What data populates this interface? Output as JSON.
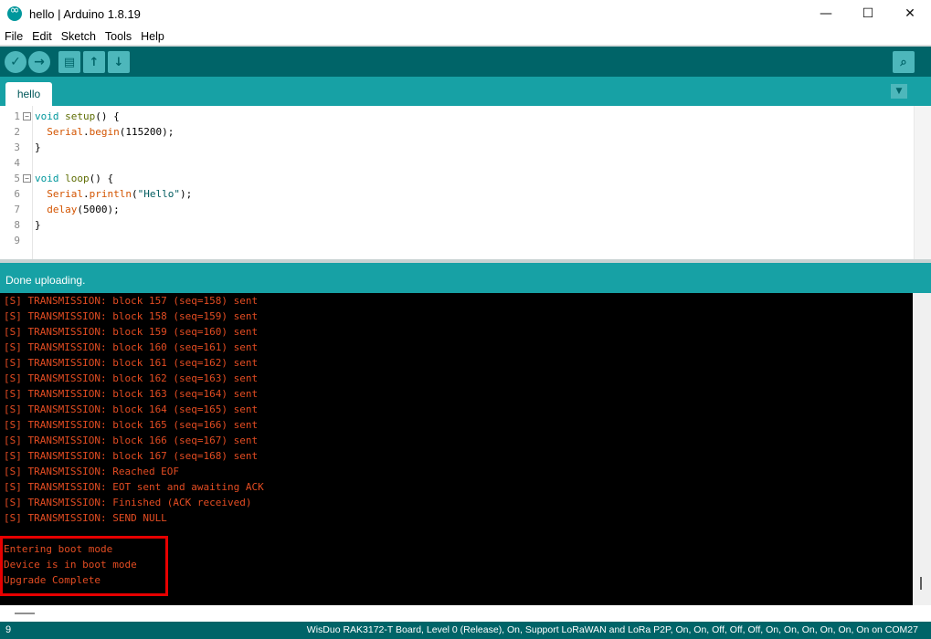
{
  "window": {
    "title": "hello | Arduino 1.8.19",
    "icon": "arduino-logo-icon",
    "controls": {
      "minimize": "—",
      "maximize": "☐",
      "close": "✕"
    }
  },
  "menu": [
    "File",
    "Edit",
    "Sketch",
    "Tools",
    "Help"
  ],
  "toolbar": {
    "verify": "✓",
    "upload": "→",
    "new": "▤",
    "open": "↑",
    "save": "↓",
    "serial_monitor": "⌕",
    "colors": {
      "bar": "#006468",
      "button": "#4db7bb"
    }
  },
  "tabs": [
    {
      "label": "hello",
      "active": true
    }
  ],
  "tab_menu_glyph": "▼",
  "editor": {
    "lines": [
      {
        "n": "1",
        "fold": "−"
      },
      {
        "n": "2"
      },
      {
        "n": "3"
      },
      {
        "n": "4"
      },
      {
        "n": "5",
        "fold": "−"
      },
      {
        "n": "6"
      },
      {
        "n": "7"
      },
      {
        "n": "8"
      },
      {
        "n": "9"
      }
    ],
    "code": {
      "l1_kw": "void",
      "l1_fn": "setup",
      "l1_rest": "() {",
      "l2_cls": "Serial",
      "l2_dot": ".",
      "l2_fn": "begin",
      "l2_rest": "(115200);",
      "l3": "}",
      "l5_kw": "void",
      "l5_fn": "loop",
      "l5_rest": "() {",
      "l6_cls": "Serial",
      "l6_dot": ".",
      "l6_fn": "println",
      "l6_open": "(",
      "l6_str": "\"Hello\"",
      "l6_close": ");",
      "l7_fn": "delay",
      "l7_rest": "(5000);",
      "l8": "}"
    }
  },
  "status": {
    "message": "Done uploading."
  },
  "console": {
    "lines": [
      "[S] TRANSMISSION: block 157 (seq=158) sent",
      "[S] TRANSMISSION: block 158 (seq=159) sent",
      "[S] TRANSMISSION: block 159 (seq=160) sent",
      "[S] TRANSMISSION: block 160 (seq=161) sent",
      "[S] TRANSMISSION: block 161 (seq=162) sent",
      "[S] TRANSMISSION: block 162 (seq=163) sent",
      "[S] TRANSMISSION: block 163 (seq=164) sent",
      "[S] TRANSMISSION: block 164 (seq=165) sent",
      "[S] TRANSMISSION: block 165 (seq=166) sent",
      "[S] TRANSMISSION: block 166 (seq=167) sent",
      "[S] TRANSMISSION: block 167 (seq=168) sent",
      "[S] TRANSMISSION: Reached EOF",
      "[S] TRANSMISSION: EOT sent and awaiting ACK",
      "[S] TRANSMISSION: Finished (ACK received)",
      "[S] TRANSMISSION: SEND NULL",
      "",
      "Entering boot mode",
      "Device is in boot mode",
      "Upgrade Complete"
    ],
    "text_color": "#e34c22",
    "highlight_color": "#e60000"
  },
  "footer": {
    "line_number": "9",
    "board": "WisDuo RAK3172-T Board, Level 0 (Release), On, Support LoRaWAN and LoRa P2P, On, On, Off, Off, Off, On, On, On, On, On, On on COM27"
  }
}
